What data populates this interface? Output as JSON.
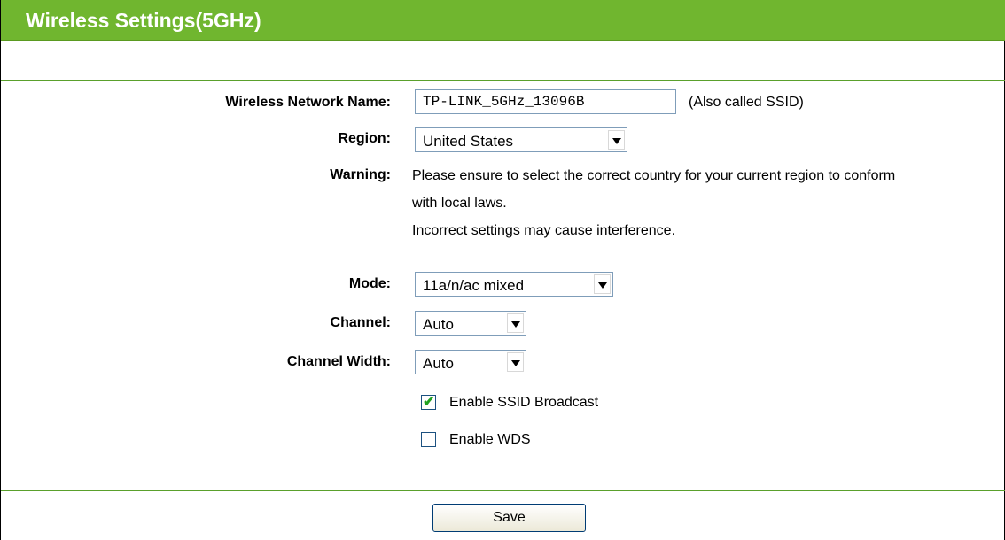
{
  "header": {
    "title": "Wireless Settings(5GHz)"
  },
  "form": {
    "ssid": {
      "label": "Wireless Network Name:",
      "value": "TP-LINK_5GHz_13096B",
      "note": "(Also called SSID)"
    },
    "region": {
      "label": "Region:",
      "value": "United States"
    },
    "warning": {
      "label": "Warning:",
      "line1": "Please ensure to select the correct country for your current region to conform",
      "line2": "with local laws.",
      "line3": "Incorrect settings may cause interference."
    },
    "mode": {
      "label": "Mode:",
      "value": "11a/n/ac mixed"
    },
    "channel": {
      "label": "Channel:",
      "value": "Auto"
    },
    "channel_width": {
      "label": "Channel Width:",
      "value": "Auto"
    },
    "ssid_broadcast": {
      "label": "Enable SSID Broadcast",
      "checked": true,
      "mark": "✔"
    },
    "wds": {
      "label": "Enable WDS",
      "checked": false
    }
  },
  "actions": {
    "save_label": "Save"
  },
  "colors": {
    "header_bg": "#70b62f",
    "line": "#5aa02c",
    "check": "#21a121"
  },
  "icons": {
    "dropdown": "chevron-down-icon",
    "check": "checkmark-icon"
  }
}
